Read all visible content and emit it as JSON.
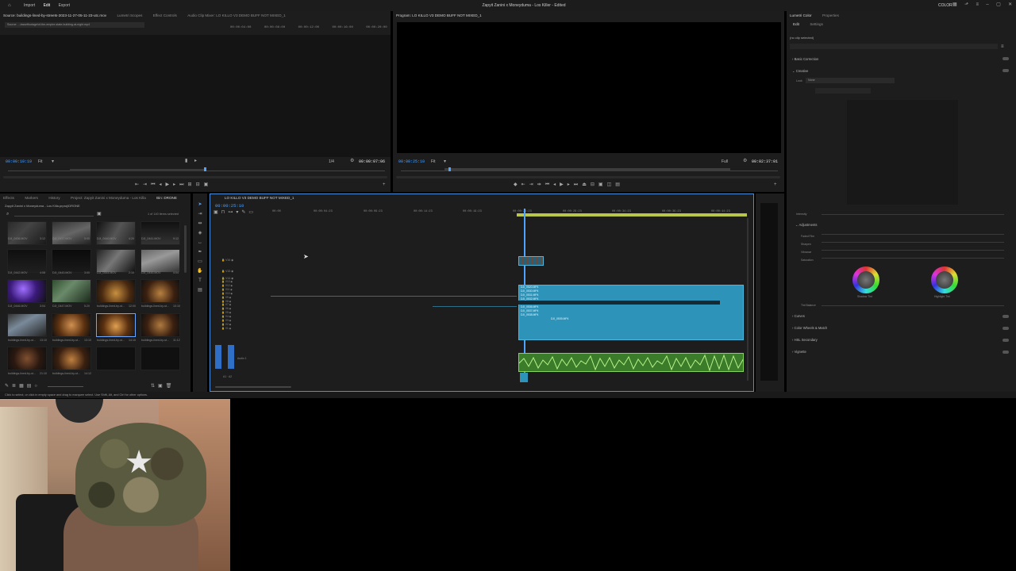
{
  "topbar": {
    "menu": [
      "Import",
      "Edit",
      "Export"
    ],
    "title": "Zapyit Zanini x Moneyduma - Los Killer - Edited",
    "workspace": "COLOR"
  },
  "source_monitor": {
    "tabs": [
      "Source: buildings-lined-by-streets-2023-11-27-05-11-23-utc.mov",
      "Lumetri Scopes",
      "Effect Controls",
      "Audio Clip Mixer: LO KILLO V3 DEMO BUFF NOT MIXED_1"
    ],
    "clip_path": "Source: .../assetfootage/of-the-empire-state-building-at-night.mp4",
    "timecode_left": "00:00:10:19",
    "fit": "Fit",
    "resolution": "1/4",
    "timecode_right": "00:00:07:06",
    "ruler_times": [
      "00:00:04:00",
      "00:00:08:00",
      "00:00:12:00",
      "00:00:16:00",
      "00:00:20:00"
    ]
  },
  "program_monitor": {
    "tab": "Program: LO KILLO V3 DEMO BUFF NOT MIXED_1",
    "timecode_left": "00:00:25:10",
    "fit": "Fit",
    "resolution": "Full",
    "timecode_right": "00:02:37:01"
  },
  "project_panel": {
    "tabs": [
      "Effects",
      "Markers",
      "History",
      "Project: Zapyit Zanini x Moneyduma - Los Killa",
      "Bin: DRONE"
    ],
    "path": "Zapyit Zanini x Moneyduma - Los Killa.prproj\\DRONE",
    "count": "1 of 140 items selected",
    "thumbnails": [
      {
        "label": "DJI_0436.MOV",
        "dur": "3:12"
      },
      {
        "label": "DJI_0437.MOV",
        "dur": "5:00"
      },
      {
        "label": "DJI_0440.MOV",
        "dur": "4:20"
      },
      {
        "label": "DJI_0441.MOV",
        "dur": "9:12"
      },
      {
        "label": "DJI_0442.MOV",
        "dur": "4:08"
      },
      {
        "label": "DJI_0443.MOV",
        "dur": "3:00"
      },
      {
        "label": "DJI_0444.MOV",
        "dur": "2:10"
      },
      {
        "label": "DJI_0445.MOV",
        "dur": "4:04"
      },
      {
        "label": "DJI_0446.MOV",
        "dur": "3:04"
      },
      {
        "label": "DJI_0447.MOV",
        "dur": "5:20"
      },
      {
        "label": "buildings-lined-by-st...",
        "dur": "12:00"
      },
      {
        "label": "buildings-lined-by-st...",
        "dur": "10:10"
      },
      {
        "label": "buildings-lined-by-st...",
        "dur": "13:10"
      },
      {
        "label": "buildings-lined-by-st...",
        "dur": "13:10"
      },
      {
        "label": "buildings-lined-by-st...",
        "dur": "14:15"
      },
      {
        "label": "buildings-lined-by-st...",
        "dur": "11:12"
      },
      {
        "label": "buildings-lined-by-st...",
        "dur": "21:10"
      },
      {
        "label": "buildings-lined-by-st...",
        "dur": "14:12"
      },
      {
        "label": "",
        "dur": ""
      },
      {
        "label": "",
        "dur": ""
      }
    ]
  },
  "timeline": {
    "tab": "LO KILLO V3 DEMO BUFF NOT MIXED_1",
    "timecode": "00:00:25:10",
    "ruler_times": [
      "00:00",
      "00:00:04:23",
      "00:00:09:23",
      "00:00:14:23",
      "00:00:19:23",
      "00:00:24:23",
      "00:00:29:23",
      "00:00:34:23",
      "00:00:39:23",
      "00:00:44:23"
    ],
    "video_tracks": [
      "V16",
      "V15",
      "V14",
      "V13",
      "V12",
      "V11",
      "V10",
      "V9",
      "V8",
      "V7",
      "V6",
      "V5",
      "V4",
      "V3",
      "V2",
      "V1"
    ],
    "audio_tracks": [
      "A1",
      "A2"
    ],
    "audio_label": "Audio 1",
    "clips": [
      {
        "label": "DJI_0520.MP4"
      },
      {
        "label": "DJI_0530.MP4"
      },
      {
        "label": "DJI_0531.MP4"
      },
      {
        "label": "DJI_0532.MP4"
      },
      {
        "label": "DJI_0533.MP4"
      },
      {
        "label": "DJI_0536.MP4"
      },
      {
        "label": "DJI_0537.MP4"
      },
      {
        "label": "DJI_0538.MP4"
      },
      {
        "label": "DJI_0539.MP4"
      }
    ]
  },
  "lumetri": {
    "tabs": [
      "Lumetri Color",
      "Properties"
    ],
    "subtabs": [
      "Edit",
      "Settings"
    ],
    "no_clip": "(no clip selected)",
    "sections": [
      "Basic Correction",
      "Creative",
      "Curves",
      "Color Wheels & Match",
      "HSL Secondary",
      "Vignette"
    ],
    "look_label": "Look",
    "look_value": "None",
    "intensity": "Intensity",
    "adjustments": "Adjustments",
    "adjust_items": [
      "Faded Film",
      "Sharpen",
      "Vibrance",
      "Saturation"
    ],
    "wheels": [
      "Shadow Tint",
      "Highlight Tint"
    ],
    "tint_balance": "Tint Balance"
  },
  "status_bar": {
    "text": "Click to select, or click in empty space and drag to marquee select. Use Shift, Alt, and Ctrl for other options."
  }
}
